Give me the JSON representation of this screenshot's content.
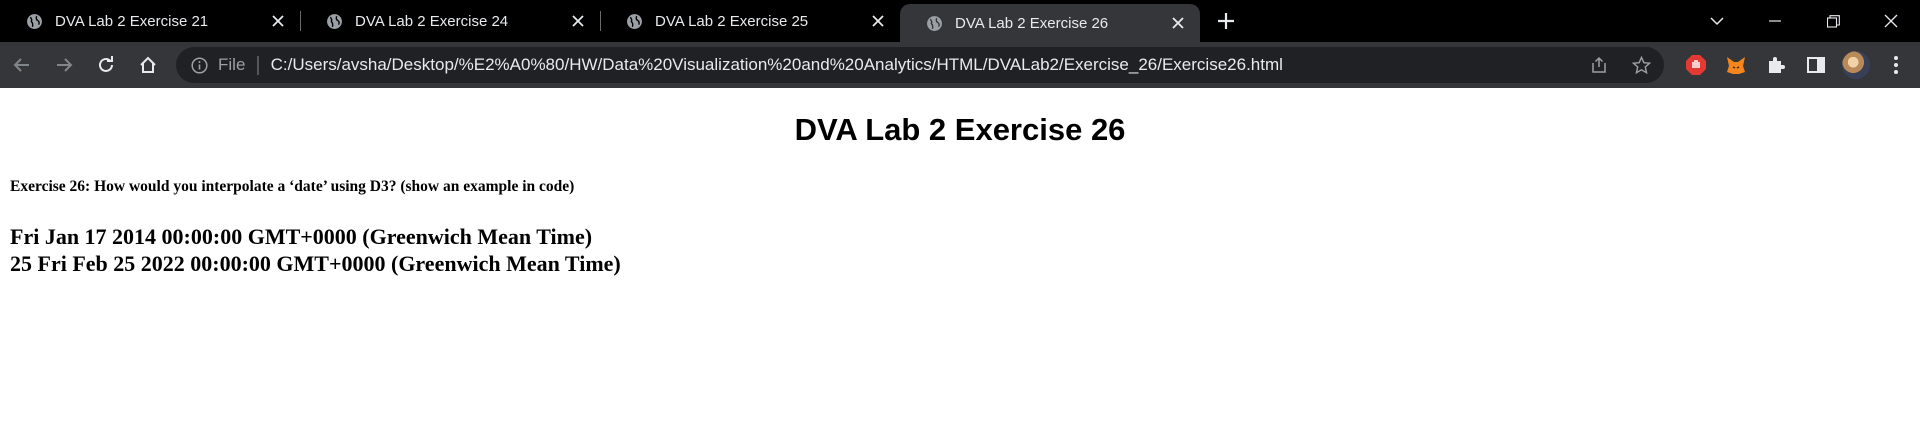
{
  "browser": {
    "tabs": [
      {
        "label": "DVA Lab 2 Exercise 21",
        "active": false
      },
      {
        "label": "DVA Lab 2 Exercise 24",
        "active": false
      },
      {
        "label": "DVA Lab 2 Exercise 25",
        "active": false
      },
      {
        "label": "DVA Lab 2 Exercise 26",
        "active": true
      }
    ],
    "new_tab_icon": "plus-icon",
    "address_bar": {
      "scheme_label": "File",
      "url": "C:/Users/avsha/Desktop/%E2%A0%80/HW/Data%20Visualization%20and%20Analytics/HTML/DVALab2/Exercise_26/Exercise26.html"
    },
    "colors": {
      "tabstrip_bg": "#000000",
      "toolbar_bg": "#35363a",
      "omnibox_bg": "#202124",
      "text": "#e8eaed"
    }
  },
  "page": {
    "heading": "DVA Lab 2 Exercise 26",
    "question": "Exercise 26: How would you interpolate a ‘date’ using D3? (show an example in code)",
    "output_lines": [
      "Fri Jan 17 2014 00:00:00 GMT+0000 (Greenwich Mean Time)",
      "25 Fri Feb 25 2022 00:00:00 GMT+0000 (Greenwich Mean Time)"
    ]
  }
}
